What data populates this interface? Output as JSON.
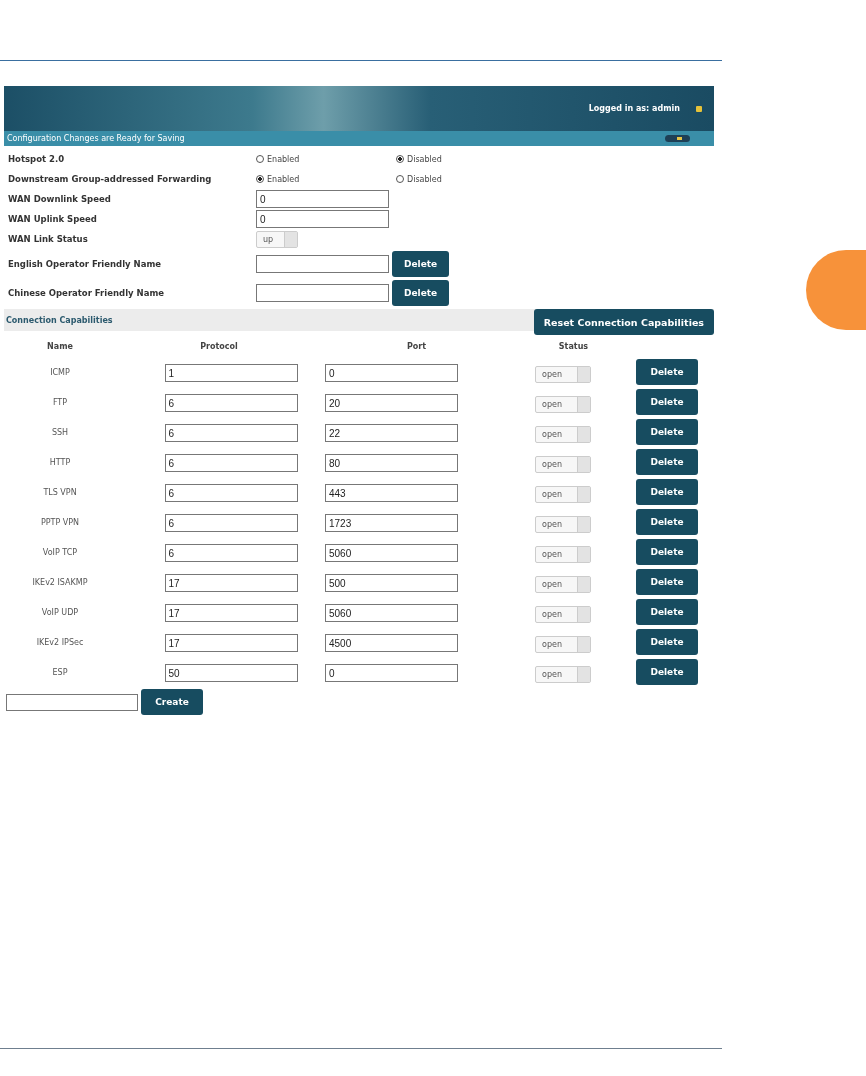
{
  "header": {
    "login": "Logged in as: admin"
  },
  "notice": {
    "text": "Configuration Changes are Ready for Saving"
  },
  "settings": [
    {
      "kind": "radio",
      "label": "Hotspot 2.0",
      "options": [
        {
          "label": "Enabled",
          "selected": false
        },
        {
          "label": "Disabled",
          "selected": true
        }
      ]
    },
    {
      "kind": "radio",
      "label": "Downstream Group-addressed Forwarding",
      "options": [
        {
          "label": "Enabled",
          "selected": true
        },
        {
          "label": "Disabled",
          "selected": false
        }
      ]
    },
    {
      "kind": "text",
      "label": "WAN Downlink Speed",
      "value": "0"
    },
    {
      "kind": "text",
      "label": "WAN Uplink Speed",
      "value": "0"
    },
    {
      "kind": "select",
      "label": "WAN Link Status",
      "value": "up"
    },
    {
      "kind": "text_delete",
      "label": "English Operator Friendly Name",
      "button": "Delete"
    },
    {
      "kind": "text_delete",
      "label": "Chinese Operator Friendly Name",
      "button": "Delete"
    }
  ],
  "capabilities": {
    "title": "Connection Capabilities",
    "reset_button": "Reset Connection Capabilities",
    "columns": [
      "Name",
      "Protocol",
      "Port",
      "Status"
    ],
    "rows": [
      {
        "name": "ICMP",
        "protocol": "1",
        "port": "0",
        "status": "open",
        "button": "Delete"
      },
      {
        "name": "FTP",
        "protocol": "6",
        "port": "20",
        "status": "open",
        "button": "Delete"
      },
      {
        "name": "SSH",
        "protocol": "6",
        "port": "22",
        "status": "open",
        "button": "Delete"
      },
      {
        "name": "HTTP",
        "protocol": "6",
        "port": "80",
        "status": "open",
        "button": "Delete"
      },
      {
        "name": "TLS VPN",
        "protocol": "6",
        "port": "443",
        "status": "open",
        "button": "Delete"
      },
      {
        "name": "PPTP VPN",
        "protocol": "6",
        "port": "1723",
        "status": "open",
        "button": "Delete"
      },
      {
        "name": "VoIP TCP",
        "protocol": "6",
        "port": "5060",
        "status": "open",
        "button": "Delete"
      },
      {
        "name": "IKEv2 ISAKMP",
        "protocol": "17",
        "port": "500",
        "status": "open",
        "button": "Delete"
      },
      {
        "name": "VoIP UDP",
        "protocol": "17",
        "port": "5060",
        "status": "open",
        "button": "Delete"
      },
      {
        "name": "IKEv2 IPSec",
        "protocol": "17",
        "port": "4500",
        "status": "open",
        "button": "Delete"
      },
      {
        "name": "ESP",
        "protocol": "50",
        "port": "0",
        "status": "open",
        "button": "Delete"
      }
    ],
    "create_button": "Create"
  }
}
